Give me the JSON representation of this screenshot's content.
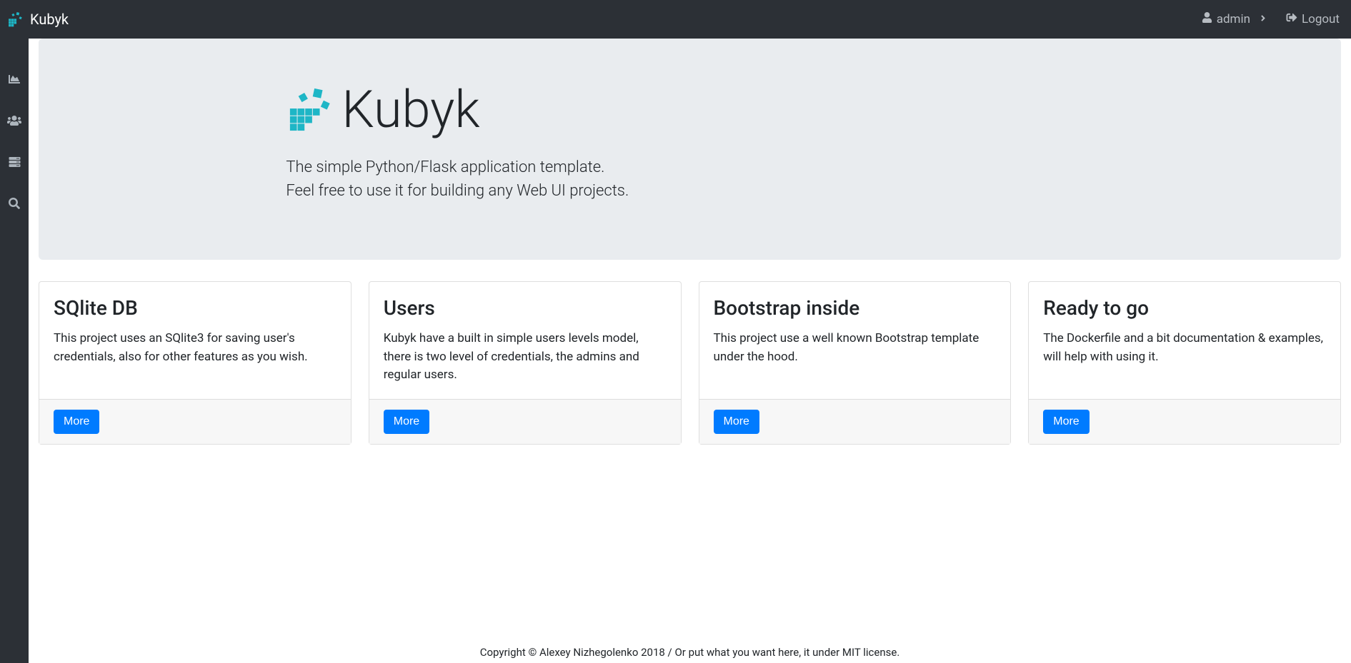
{
  "brand": "Kubyk",
  "navbar": {
    "username": "admin",
    "logout_label": "Logout"
  },
  "jumbotron": {
    "title": "Kubyk",
    "line1": "The simple Python/Flask application template.",
    "line2": "Feel free to use it for building any Web UI projects."
  },
  "cards": [
    {
      "title": "SQlite DB",
      "text": "This project uses an SQlite3 for saving user's credentials, also for other features as you wish.",
      "button": "More"
    },
    {
      "title": "Users",
      "text": "Kubyk have a built in simple users levels model, there is two level of credentials, the admins and regular users.",
      "button": "More"
    },
    {
      "title": "Bootstrap inside",
      "text": "This project use a well known Bootstrap template under the hood.",
      "button": "More"
    },
    {
      "title": "Ready to go",
      "text": "The Dockerfile and a bit documentation & examples, will help with using it.",
      "button": "More"
    }
  ],
  "footer": "Copyright © Alexey Nizhegolenko 2018 / Or put what you want here, it under MIT license.",
  "sidebar": {
    "items": [
      "chart-area-icon",
      "users-icon",
      "server-icon",
      "search-icon"
    ]
  }
}
